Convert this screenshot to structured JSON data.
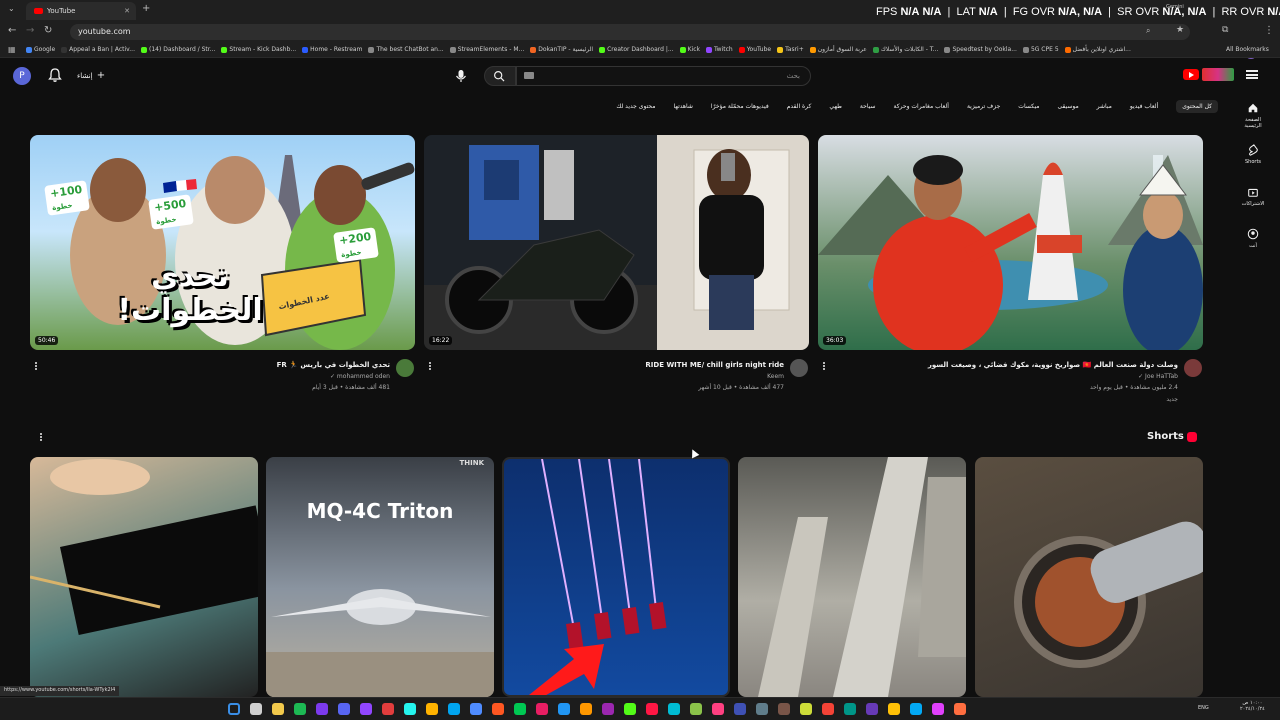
{
  "browser": {
    "tab_title": "YouTube",
    "new_tab": "+",
    "url": "youtube.com",
    "status_url": "https://www.youtube.com/shorts/lla-WTyk2I4",
    "overlay": {
      "fps_label": "FPS",
      "fps_value": "N/A",
      "fps_value2": "N/A",
      "lat_label": "LAT",
      "lat_value": "N/A",
      "fg_label": "FG OVR",
      "fg_value": "N/A, N/A",
      "sr_label": "SR OVR",
      "sr_value": "N/A, N/A",
      "rr_label": "RR OVR",
      "rr_value": "N/A, N/A",
      "gemini_label": "Gemini"
    },
    "all_bookmarks": "All Bookmarks",
    "bookmarks": [
      {
        "label": "Google",
        "color": "#4285f4"
      },
      {
        "label": "Appeal a Ban | Activ...",
        "color": "#333333"
      },
      {
        "label": "(14) Dashboard / Str...",
        "color": "#53fc18"
      },
      {
        "label": "Stream - Kick Dashb...",
        "color": "#53fc18"
      },
      {
        "label": "Home - Restream",
        "color": "#2b5cff"
      },
      {
        "label": "The best ChatBot an...",
        "color": "#888888"
      },
      {
        "label": "StreamElements - M...",
        "color": "#888888"
      },
      {
        "label": "DokanTIP - الرئيسية",
        "color": "#f26522"
      },
      {
        "label": "Creator Dashboard |...",
        "color": "#53fc18"
      },
      {
        "label": "Kick",
        "color": "#53fc18"
      },
      {
        "label": "Twitch",
        "color": "#9146ff"
      },
      {
        "label": "YouTube",
        "color": "#ff0000"
      },
      {
        "label": "Tasri+",
        "color": "#f5c518"
      },
      {
        "label": "عربة السوق أمازون",
        "color": "#ff9900"
      },
      {
        "label": "الكابلات والأسلاك - T...",
        "color": "#2f9e44"
      },
      {
        "label": "Speedtest by Ookla...",
        "color": "#888888"
      },
      {
        "label": "5G CPE 5",
        "color": "#888888"
      },
      {
        "label": "اشتري اونلاين بأفضل...",
        "color": "#ff6b00"
      }
    ]
  },
  "yt": {
    "avatar_letter": "P",
    "create_label": "إنشاء",
    "search_placeholder": "بحث",
    "sidebar": [
      {
        "label": "الصفحة الرئيسية",
        "icon": "home-icon"
      },
      {
        "label": "Shorts",
        "icon": "shorts-icon"
      },
      {
        "label": "الاشتراكات",
        "icon": "subscriptions-icon"
      },
      {
        "label": "أنت",
        "icon": "you-icon"
      }
    ],
    "chips": [
      "كل المحتوى",
      "ألعاب فيديو",
      "مباشر",
      "موسيقى",
      "ميكسات",
      "جزف ترميزية",
      "ألعاب مغامرات وحركة",
      "سياحة",
      "طهي",
      "كرة القدم",
      "فيديوهات محمّلة مؤخرًا",
      "شاهدتها",
      "محتوى جديد لك"
    ],
    "videos": [
      {
        "title": "تحدي الخطوات في باريس 🏃 FR",
        "channel": "mohammed oden",
        "meta": "481 ألف مشاهدة • قبل 3 أيام",
        "duration": "50:46",
        "thumb_text": "تحدي الخطوات!",
        "extra": ""
      },
      {
        "title": "RIDE WITH ME/ chill girls night ride",
        "channel": "Keem",
        "meta": "477 ألف مشاهدة • قبل 10 أشهر",
        "duration": "16:22",
        "thumb_text": "",
        "extra": ""
      },
      {
        "title": "وصلت دولة صنعت العالم 🇰🇬 صواريخ نووية، مكوك فضائي ، وصيغت السور",
        "channel": "Joe HaTTab",
        "meta": "2.4 مليون مشاهدة • قبل يوم واحد",
        "duration": "36:03",
        "thumb_text": "",
        "extra": "جديد"
      }
    ],
    "thumb_badges": [
      "+100",
      "خطوة",
      "+500",
      "خطوة",
      "+200",
      "خطوة",
      "عدد الخطوات"
    ],
    "shorts_title": "Shorts",
    "shorts": [
      {
        "label": "",
        "color_a": "#8a6a4a",
        "color_b": "#1a1a1a"
      },
      {
        "label": "MQ-4C Triton",
        "color_a": "#c8ccd2",
        "color_b": "#8f97a3"
      },
      {
        "label": "",
        "color_a": "#0f3a8a",
        "color_b": "#6a2cc8"
      },
      {
        "label": "",
        "color_a": "#a8a8a8",
        "color_b": "#6a6a6a"
      },
      {
        "label": "",
        "color_a": "#6b5a45",
        "color_b": "#2b2b2b"
      }
    ],
    "think_badge": "THINK"
  },
  "taskbar": {
    "lang": "ENG",
    "time": "١٠:٠٠ ص",
    "date": "٢٠٢٤/١٠/٢٤"
  }
}
